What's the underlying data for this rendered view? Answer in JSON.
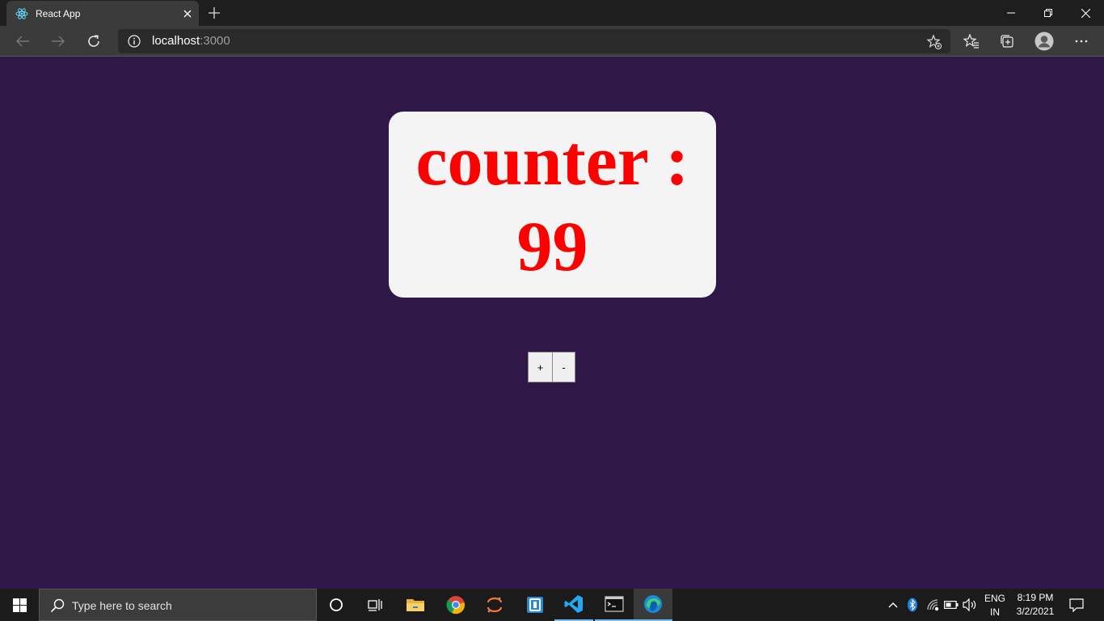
{
  "browser": {
    "tab": {
      "title": "React App",
      "favicon": "react-logo-icon"
    },
    "address": {
      "host": "localhost",
      "port": ":3000"
    },
    "colors": {
      "titlebar": "#1e1e1e",
      "toolbar": "#3b3b3b"
    }
  },
  "page": {
    "background": "#2f1848",
    "counter": {
      "label": "counter :",
      "value": "99",
      "color": "#ff0000"
    },
    "buttons": {
      "increment": "+",
      "decrement": "-"
    }
  },
  "taskbar": {
    "search_placeholder": "Type here to search",
    "apps": [
      "cortana-icon",
      "task-view-icon",
      "file-explorer-icon",
      "chrome-icon",
      "jupyter-icon",
      "sandbox-icon",
      "vscode-icon",
      "terminal-icon",
      "edge-icon"
    ],
    "tray": {
      "language": "ENG",
      "region": "IN",
      "time": "8:19 PM",
      "date": "3/2/2021"
    }
  }
}
